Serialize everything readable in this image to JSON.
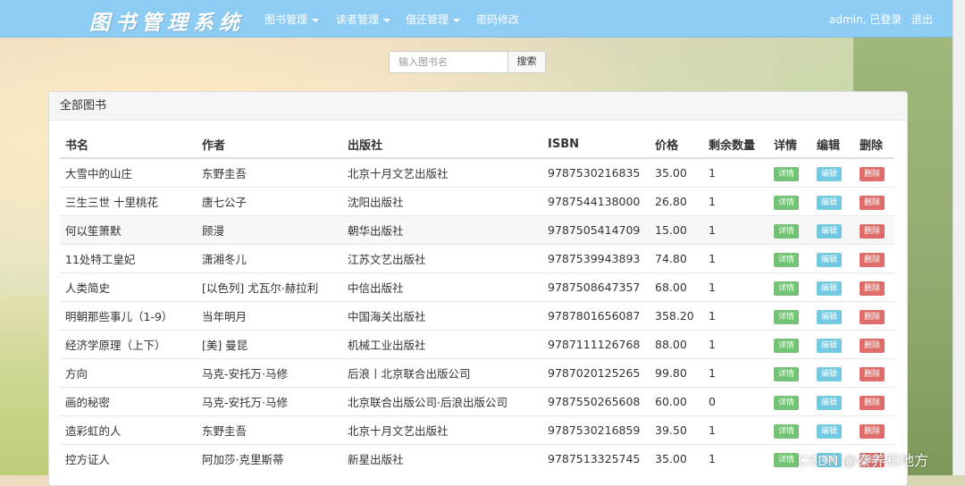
{
  "navbar": {
    "brand": "图书管理系统",
    "menus": [
      {
        "label": "图书管理"
      },
      {
        "label": "读者管理"
      },
      {
        "label": "借还管理"
      }
    ],
    "password_link": "密码修改",
    "user_status": "admin, 已登录",
    "logout": "退出"
  },
  "search": {
    "placeholder": "输入图书名",
    "button": "搜索"
  },
  "panel": {
    "title": "全部图书",
    "columns": [
      "书名",
      "作者",
      "出版社",
      "ISBN",
      "价格",
      "剩余数量",
      "详情",
      "编辑",
      "删除"
    ],
    "actions": {
      "detail": "详情",
      "edit": "编辑",
      "delete": "删除"
    },
    "rows": [
      [
        "大雪中的山庄",
        "东野圭吾",
        "北京十月文艺出版社",
        "9787530216835",
        "35.00",
        "1"
      ],
      [
        "三生三世 十里桃花",
        "唐七公子",
        "沈阳出版社",
        "9787544138000",
        "26.80",
        "1"
      ],
      [
        "何以笙箫默",
        "顾漫",
        "朝华出版社",
        "9787505414709",
        "15.00",
        "1"
      ],
      [
        "11处特工皇妃",
        "潇湘冬儿",
        "江苏文艺出版社",
        "9787539943893",
        "74.80",
        "1"
      ],
      [
        "人类简史",
        "[以色列] 尤瓦尔·赫拉利",
        "中信出版社",
        "9787508647357",
        "68.00",
        "1"
      ],
      [
        "明朝那些事儿（1-9）",
        "当年明月",
        "中国海关出版社",
        "9787801656087",
        "358.20",
        "1"
      ],
      [
        "经济学原理（上下）",
        "[美] 曼昆",
        "机械工业出版社",
        "9787111126768",
        "88.00",
        "1"
      ],
      [
        "方向",
        "马克-安托万·马修",
        "后浪丨北京联合出版公司",
        "9787020125265",
        "99.80",
        "1"
      ],
      [
        "画的秘密",
        "马克-安托万·马修",
        "北京联合出版公司·后浪出版公司",
        "9787550265608",
        "60.00",
        "0"
      ],
      [
        "造彩虹的人",
        "东野圭吾",
        "北京十月文艺出版社",
        "9787530216859",
        "39.50",
        "1"
      ],
      [
        "控方证人",
        "阿加莎·克里斯蒂",
        "新星出版社",
        "9787513325745",
        "35.00",
        "1"
      ]
    ]
  },
  "watermark": "CSDN @秦养和地方"
}
